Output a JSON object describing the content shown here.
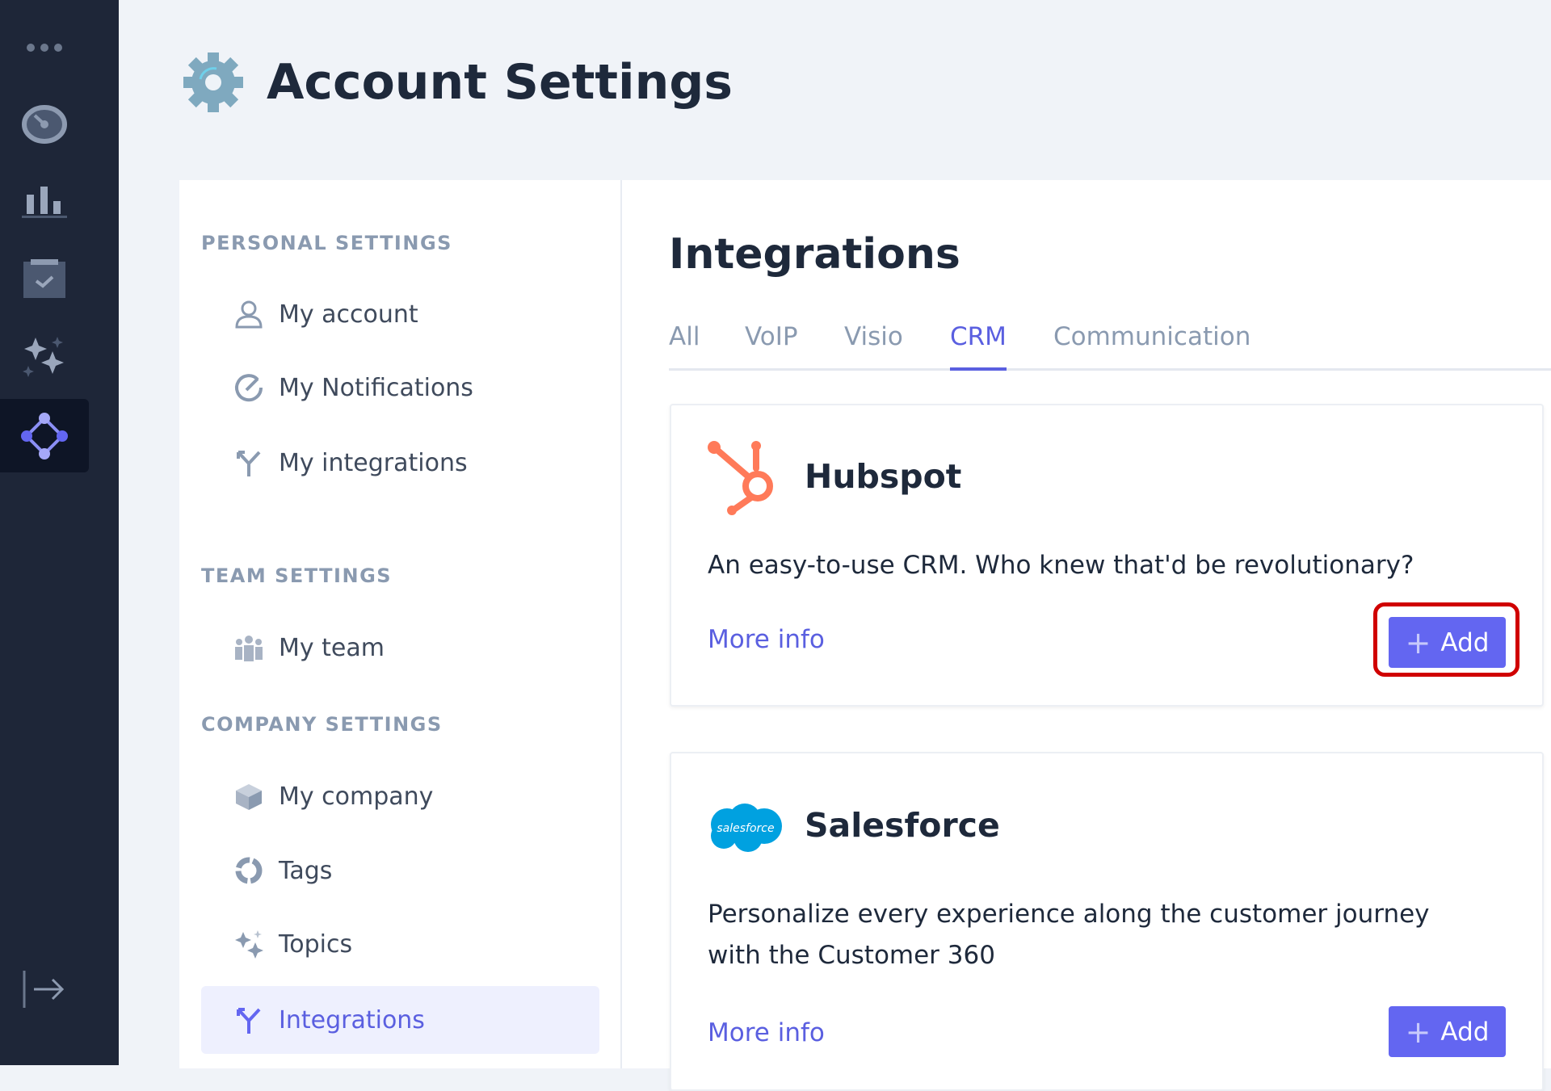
{
  "page": {
    "title": "Account Settings"
  },
  "rail": {
    "items": [
      "more-icon",
      "dashboard-icon",
      "analytics-icon",
      "tasks-icon",
      "topics-icon",
      "integrations-icon",
      "logout-icon"
    ]
  },
  "settings_nav": {
    "personal": {
      "heading": "PERSONAL SETTINGS",
      "items": [
        "My account",
        "My Notifications",
        "My integrations"
      ]
    },
    "team": {
      "heading": "TEAM SETTINGS",
      "items": [
        "My team"
      ]
    },
    "company": {
      "heading": "COMPANY SETTINGS",
      "items": [
        "My company",
        "Tags",
        "Topics",
        "Integrations"
      ]
    },
    "selected": "Integrations"
  },
  "main": {
    "title": "Integrations",
    "tabs": [
      "All",
      "VoIP",
      "Visio",
      "CRM",
      "Communication"
    ],
    "active_tab": "CRM",
    "cards": [
      {
        "name": "Hubspot",
        "description": "An easy-to-use CRM. Who knew that'd be revolutionary?",
        "more_label": "More info",
        "add_label": "Add",
        "logo_color": "#ff7a59"
      },
      {
        "name": "Salesforce",
        "logo_text": "salesforce",
        "description_line1": "Personalize every experience along the customer journey",
        "description_line2": "with the Customer 360",
        "more_label": "More info",
        "add_label": "Add",
        "logo_color": "#00a1e0"
      }
    ]
  },
  "colors": {
    "accent": "#6366f1",
    "rail": "#1e2638",
    "highlight": "#d00000"
  }
}
